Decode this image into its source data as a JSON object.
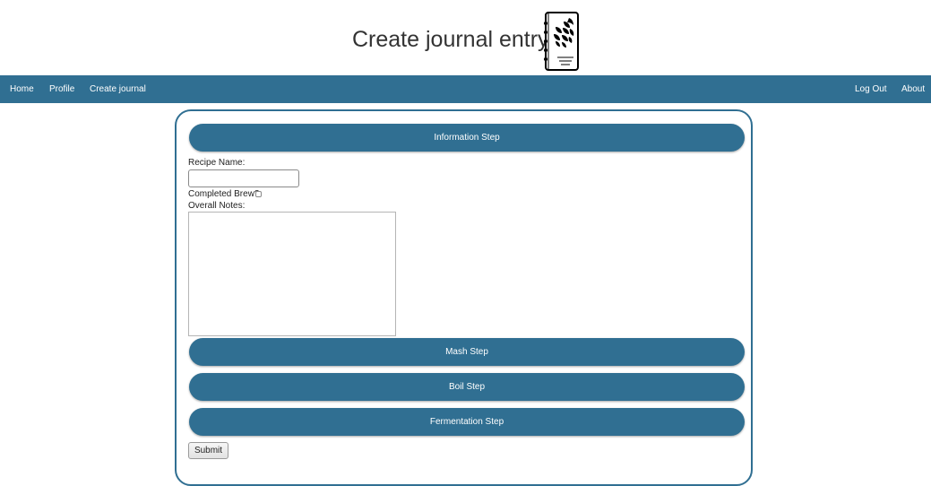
{
  "header": {
    "title": "Create journal entry",
    "logo_icon": "journal-hop-icon"
  },
  "nav": {
    "left_items": [
      {
        "label": "Home"
      },
      {
        "label": "Profile"
      },
      {
        "label": "Create journal"
      }
    ],
    "right_items": [
      {
        "label": "Log Out"
      },
      {
        "label": "About"
      }
    ]
  },
  "form": {
    "steps": {
      "information": "Information Step",
      "mash": "Mash Step",
      "boil": "Boil Step",
      "fermentation": "Fermentation Step"
    },
    "recipe_name_label": "Recipe Name:",
    "recipe_name_value": "",
    "completed_brew_label": "Completed Brew?:",
    "completed_brew_checked": false,
    "overall_notes_label": "Overall Notes:",
    "overall_notes_value": "",
    "submit_label": "Submit"
  },
  "colors": {
    "accent": "#306f92",
    "background": "#ffffff"
  }
}
